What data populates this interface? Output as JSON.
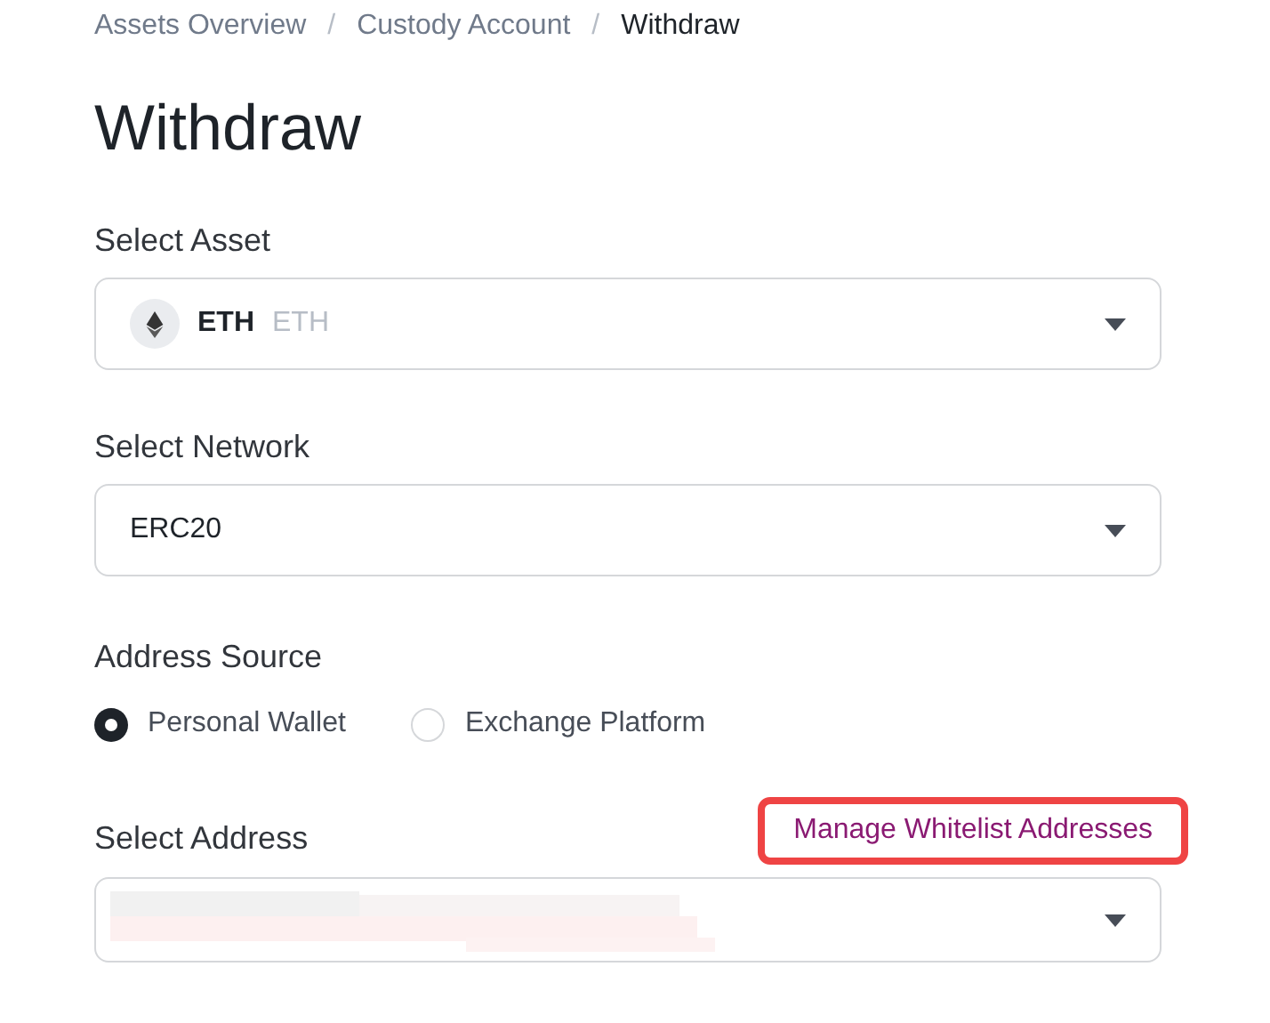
{
  "breadcrumb": [
    {
      "label": "Assets Overview",
      "current": false
    },
    {
      "label": "Custody Account",
      "current": false
    },
    {
      "label": "Withdraw",
      "current": true
    }
  ],
  "breadcrumb_separator": "/",
  "title": "Withdraw",
  "asset": {
    "label": "Select Asset",
    "symbol": "ETH",
    "name": "ETH"
  },
  "network": {
    "label": "Select Network",
    "value": "ERC20"
  },
  "address_source": {
    "label": "Address Source",
    "options": [
      {
        "label": "Personal Wallet",
        "selected": true
      },
      {
        "label": "Exchange Platform",
        "selected": false
      }
    ]
  },
  "address": {
    "label": "Select Address",
    "link": "Manage Whitelist Addresses",
    "link_highlighted": true
  }
}
